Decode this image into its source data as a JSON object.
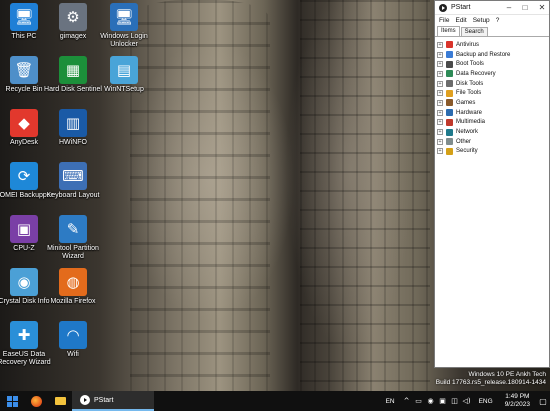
{
  "desktop": {
    "icons": [
      {
        "label": "This PC",
        "glyph": "🖥",
        "color": "#1f7fd6"
      },
      {
        "label": "gimagex",
        "glyph": "⚙",
        "color": "#6a7380"
      },
      {
        "label": "Windows Login Unlocker",
        "glyph": "🖥",
        "color": "#2a6fb8"
      },
      {
        "label": "Recycle Bin",
        "glyph": "🗑",
        "color": "#4e8fc9"
      },
      {
        "label": "Hard Disk Sentinel",
        "glyph": "▦",
        "color": "#1c8f3a"
      },
      {
        "label": "WinNTSetup",
        "glyph": "▤",
        "color": "#49a4d8"
      },
      {
        "label": "AnyDesk",
        "glyph": "◆",
        "color": "#e2382d"
      },
      {
        "label": "HWiNFO",
        "glyph": "▥",
        "color": "#1a5aa6"
      },
      {
        "label": "AOMEI Backupper",
        "glyph": "⟳",
        "color": "#1e88d8"
      },
      {
        "label": "Keyboard Layout",
        "glyph": "⌨",
        "color": "#3d6fb5"
      },
      {
        "label": "CPU-Z",
        "glyph": "▣",
        "color": "#7a3fa6"
      },
      {
        "label": "Minitool Partition Wizard",
        "glyph": "✎",
        "color": "#2d7bc4"
      },
      {
        "label": "Crystal Disk Info",
        "glyph": "◉",
        "color": "#4ba0d6"
      },
      {
        "label": "Mozilla Firefox",
        "glyph": "◍",
        "color": "#e36b1c"
      },
      {
        "label": "EaseUS Data Recovery Wizard",
        "glyph": "✚",
        "color": "#2a8fd8"
      },
      {
        "label": "Wifi",
        "glyph": "◠",
        "color": "#1f78c8"
      }
    ]
  },
  "pstart": {
    "title": "PStart",
    "menu": [
      "File",
      "Edit",
      "Setup",
      "?"
    ],
    "tabs": [
      "Items",
      "Search"
    ],
    "categories": [
      {
        "label": "Antivirus",
        "color": "#d9342b"
      },
      {
        "label": "Backup and Restore",
        "color": "#3a7bd5"
      },
      {
        "label": "Boot Tools",
        "color": "#4a4a4a"
      },
      {
        "label": "Data Recovery",
        "color": "#2e8b57"
      },
      {
        "label": "Disk Tools",
        "color": "#6b6b6b"
      },
      {
        "label": "File Tools",
        "color": "#e0a020"
      },
      {
        "label": "Games",
        "color": "#8a5a2b"
      },
      {
        "label": "Hardware",
        "color": "#2b6cb0"
      },
      {
        "label": "Multimedia",
        "color": "#c0392b"
      },
      {
        "label": "Network",
        "color": "#1f7a8c"
      },
      {
        "label": "Other",
        "color": "#7f8c8d"
      },
      {
        "label": "Security",
        "color": "#d4a017"
      }
    ]
  },
  "watermark": {
    "line1": "Windows 10 PE Ankh Tech",
    "line2": "Build 17763.rs5_release.180914-1434"
  },
  "taskbar": {
    "running_app": "PStart",
    "language": "EN",
    "language2": "ENG",
    "time": "1:49 PM",
    "date": "9/2/2023"
  }
}
